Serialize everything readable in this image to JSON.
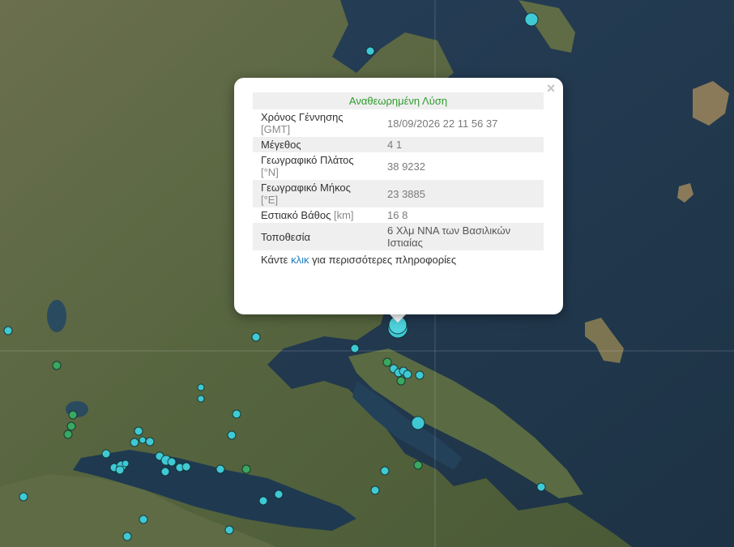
{
  "popup": {
    "title": "Αναθεωρημένη Λύση",
    "close_label": "×",
    "rows": [
      {
        "label": "Χρόνος Γέννησης",
        "unit": "[GMT]",
        "value": "18/09/2026 22 11 56 37"
      },
      {
        "label": "Μέγεθος",
        "unit": "",
        "value": "4 1"
      },
      {
        "label": "Γεωγραφικό Πλάτος",
        "unit": "[°N]",
        "value": "38 9232"
      },
      {
        "label": "Γεωγραφικό Μήκος",
        "unit": "[°E]",
        "value": "23 3885"
      },
      {
        "label": "Εστιακό Βάθος",
        "unit": "[km]",
        "value": "16 8"
      },
      {
        "label": "Τοποθεσία",
        "unit": "",
        "value": "6 Χλμ  ΝΝΑ των Βασιλικών Ιστιαίας"
      }
    ],
    "footer_prefix": "Κάντε",
    "footer_link": "κλικ",
    "footer_suffix": "για περισσότερες πληροφορίες"
  },
  "colors": {
    "sea": "#22384a",
    "land": "#5b6a45",
    "quake_cyan": "#3fc9d4",
    "quake_green": "#3aa860",
    "title_green": "#2e9b2e",
    "link_blue": "#1f7bbf"
  }
}
